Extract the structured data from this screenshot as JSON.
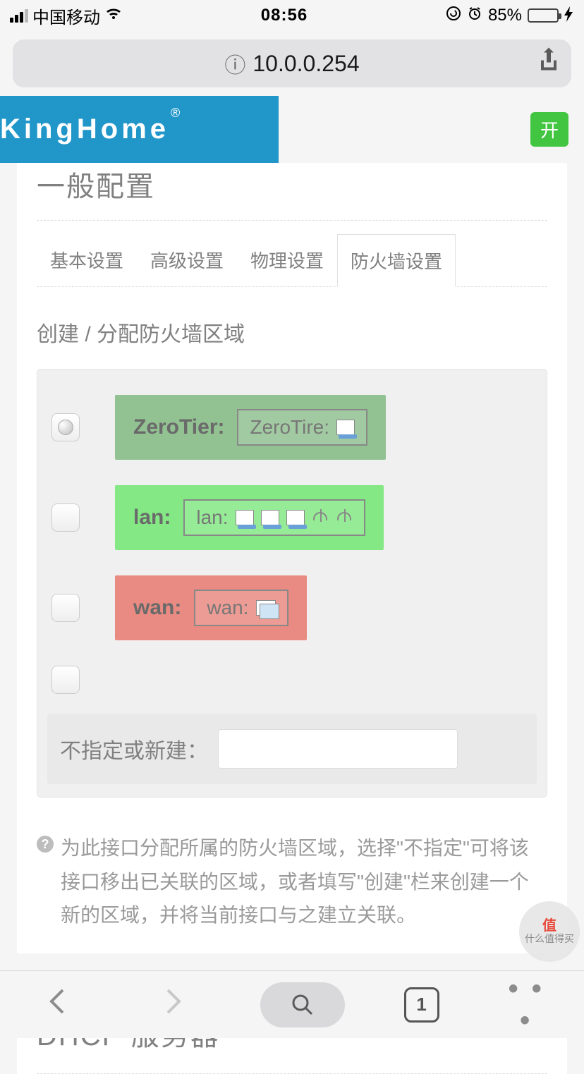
{
  "statusbar": {
    "carrier": "中国移动",
    "time": "08:56",
    "battery_pct": "85%"
  },
  "urlbar": {
    "host": "10.0.0.254"
  },
  "header": {
    "brand": "KingHome",
    "brand_mark": "®",
    "toggle": "开"
  },
  "section": {
    "title_cut": "一般配置"
  },
  "tabs": {
    "basic": "基本设置",
    "advanced": "高级设置",
    "physical": "物理设置",
    "firewall": "防火墙设置"
  },
  "form": {
    "zone_label": "创建 / 分配防火墙区域",
    "zones": {
      "zerotier": {
        "name": "ZeroTier:",
        "iface": "ZeroTire:"
      },
      "lan": {
        "name": "lan:",
        "iface": "lan:"
      },
      "wan": {
        "name": "wan:",
        "iface": "wan:"
      }
    },
    "unspecified_label": "不指定或新建：",
    "help": "为此接口分配所属的防火墙区域，选择\"不指定\"可将该接口移出已关联的区域，或者填写\"创建\"栏来创建一个新的区域，并将当前接口与之建立关联。"
  },
  "card2": {
    "title": "DHCP 服务器"
  },
  "bottombar": {
    "tab_count": "1"
  },
  "watermark": {
    "line1": "值",
    "line2": "什么值得买"
  }
}
